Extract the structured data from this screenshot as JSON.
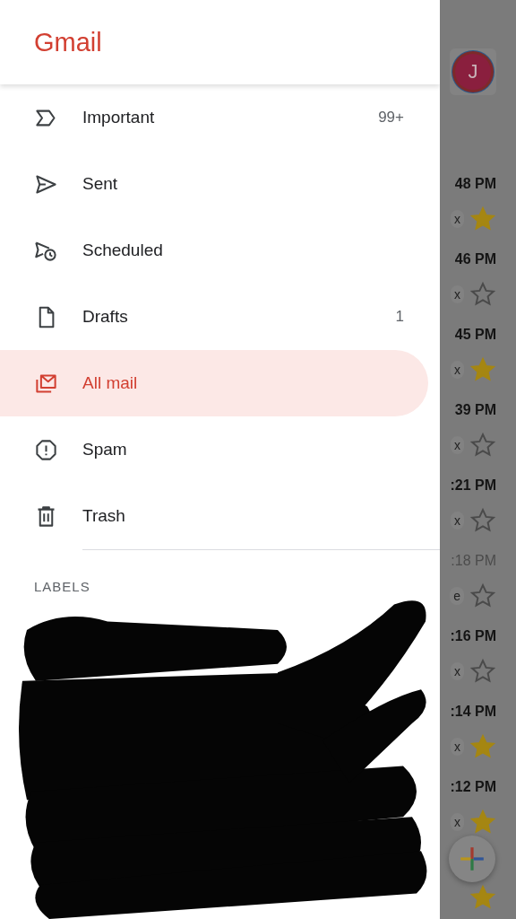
{
  "app": {
    "title": "Gmail"
  },
  "folders": [
    {
      "kind": "important",
      "label": "Important",
      "count": "99+",
      "selected": false
    },
    {
      "kind": "sent",
      "label": "Sent",
      "selected": false
    },
    {
      "kind": "scheduled",
      "label": "Scheduled",
      "selected": false
    },
    {
      "kind": "drafts",
      "label": "Drafts",
      "count": "1",
      "selected": false
    },
    {
      "kind": "allmail",
      "label": "All mail",
      "selected": true
    },
    {
      "kind": "spam",
      "label": "Spam",
      "selected": false
    },
    {
      "kind": "trash",
      "label": "Trash",
      "selected": false
    }
  ],
  "labels_heading": "LABELS",
  "mail_list": {
    "avatar_initial": "J",
    "rows": [
      {
        "time": "48 PM",
        "chip": "x",
        "starred": true,
        "unread": true
      },
      {
        "time": "46 PM",
        "chip": "x",
        "starred": false,
        "unread": true
      },
      {
        "time": "45 PM",
        "chip": "x",
        "starred": true,
        "unread": true
      },
      {
        "time": "39 PM",
        "chip": "x",
        "starred": false,
        "unread": true
      },
      {
        "time": ":21 PM",
        "chip": "x",
        "starred": false,
        "unread": true
      },
      {
        "time": ":18 PM",
        "chip": "e",
        "starred": false,
        "unread": false
      },
      {
        "time": ":16 PM",
        "chip": "x",
        "starred": false,
        "unread": true
      },
      {
        "time": ":14 PM",
        "chip": "x",
        "starred": true,
        "unread": true
      },
      {
        "time": ":12 PM",
        "chip": "x",
        "starred": true,
        "unread": true
      },
      {
        "starred": true
      }
    ]
  }
}
